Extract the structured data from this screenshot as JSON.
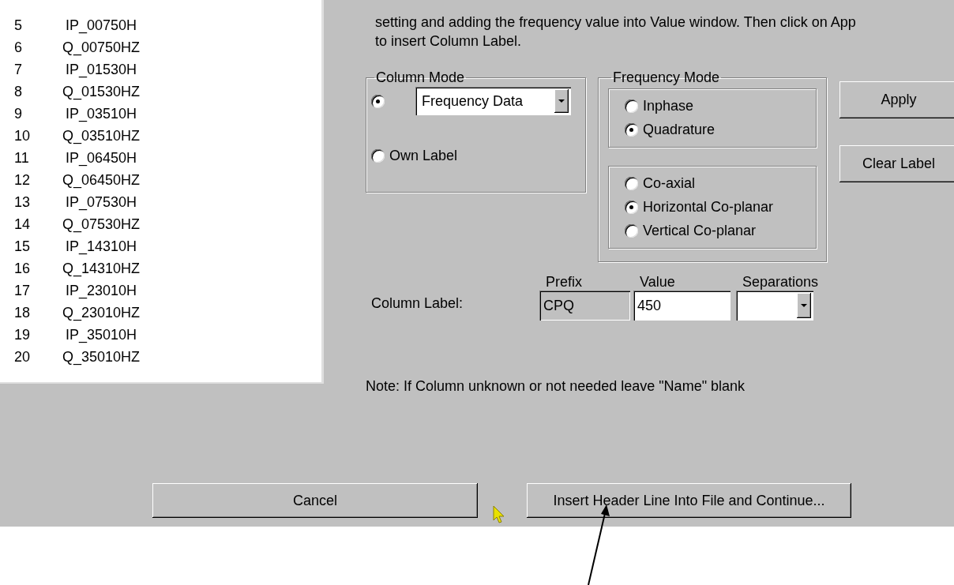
{
  "column_list": [
    {
      "number": "5",
      "name": "IP_00750H"
    },
    {
      "number": "6",
      "name": "Q_00750HZ"
    },
    {
      "number": "7",
      "name": "IP_01530H"
    },
    {
      "number": "8",
      "name": "Q_01530HZ"
    },
    {
      "number": "9",
      "name": "IP_03510H"
    },
    {
      "number": "10",
      "name": "Q_03510HZ"
    },
    {
      "number": "11",
      "name": "IP_06450H"
    },
    {
      "number": "12",
      "name": "Q_06450HZ"
    },
    {
      "number": "13",
      "name": "IP_07530H"
    },
    {
      "number": "14",
      "name": "Q_07530HZ"
    },
    {
      "number": "15",
      "name": "IP_14310H"
    },
    {
      "number": "16",
      "name": "Q_14310HZ"
    },
    {
      "number": "17",
      "name": "IP_23010H"
    },
    {
      "number": "18",
      "name": "Q_23010HZ"
    },
    {
      "number": "19",
      "name": "IP_35010H"
    },
    {
      "number": "20",
      "name": "Q_35010HZ"
    }
  ],
  "instructions": [
    "setting and adding the frequency value into Value window. Then click on App",
    "to insert Column Label."
  ],
  "column_mode": {
    "title": "Column Mode",
    "options": [
      {
        "kind": "dropdown",
        "value": "Frequency Data",
        "selected": true
      },
      {
        "kind": "label",
        "label": "Own Label",
        "selected": false
      }
    ]
  },
  "frequency_mode": {
    "title": "Frequency Mode",
    "groups": [
      [
        {
          "label": "Inphase",
          "selected": false
        },
        {
          "label": "Quadrature",
          "selected": true
        }
      ],
      [
        {
          "label": "Co-axial",
          "selected": false
        },
        {
          "label": "Horizontal Co-planar",
          "selected": true
        },
        {
          "label": "Vertical Co-planar",
          "selected": false
        }
      ]
    ]
  },
  "side_buttons": [
    "Apply",
    "Clear Label"
  ],
  "column_label": {
    "label": "Column Label:",
    "fields": [
      {
        "kind": "text",
        "header": "Prefix",
        "value": "CPQ",
        "readonly": true
      },
      {
        "kind": "text",
        "header": "Value",
        "value": "450",
        "readonly": false
      },
      {
        "kind": "combo",
        "header": "Separations"
      }
    ]
  },
  "note": "Note: If Column unknown or not needed leave \"Name\" blank",
  "buttons": [
    "Cancel",
    "Insert Header Line Into File and Continue..."
  ]
}
